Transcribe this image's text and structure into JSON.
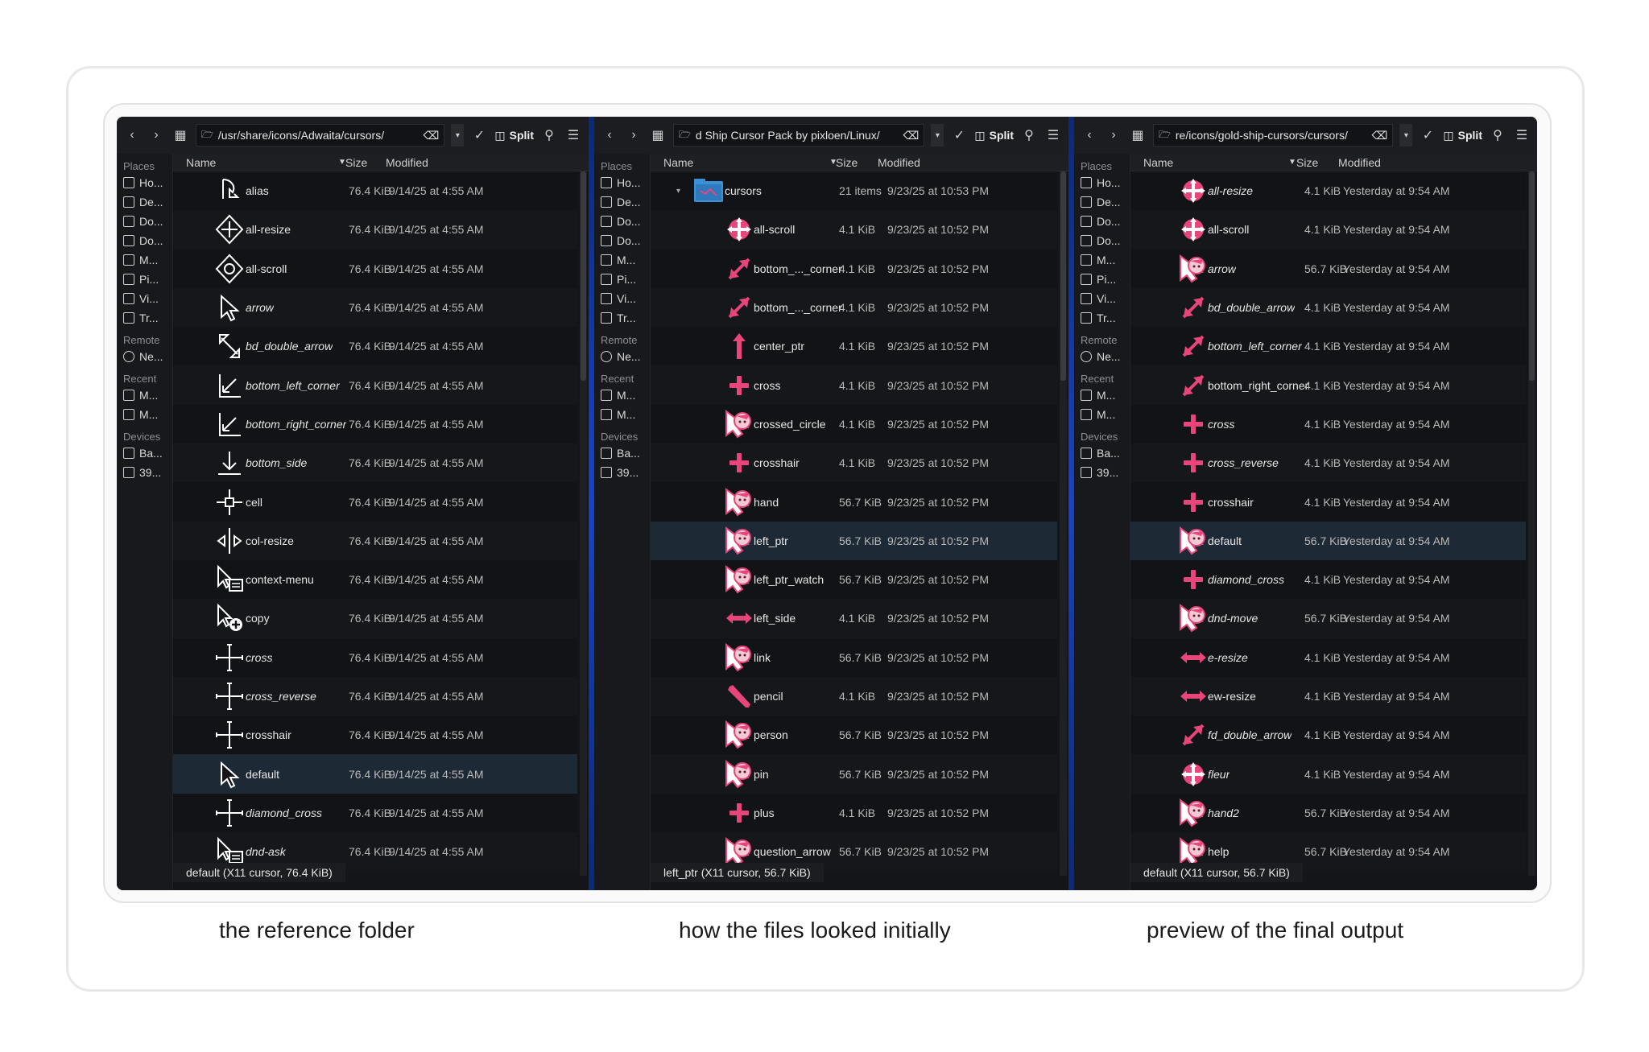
{
  "captions": [
    "the reference folder",
    "how the files looked initially",
    "preview of the final output"
  ],
  "toolbar": {
    "split_label": "Split"
  },
  "sidebar": {
    "places_header": "Places",
    "places": [
      "Ho...",
      "De...",
      "Do...",
      "Do...",
      "M...",
      "Pi...",
      "Vi...",
      "Tr..."
    ],
    "remote_header": "Remote",
    "remote": [
      "Ne..."
    ],
    "recent_header": "Recent",
    "recent": [
      "M...",
      "M..."
    ],
    "devices_header": "Devices",
    "devices": [
      "Ba...",
      "39..."
    ]
  },
  "columns": {
    "name": "Name",
    "size": "Size",
    "modified": "Modified"
  },
  "panels": [
    {
      "path": "/usr/share/icons/Adwaita/cursors/",
      "status": "default (X11 cursor, 76.4 KiB)",
      "icon_style": "adwaita",
      "selected_index": 15,
      "rows": [
        {
          "name": "alias",
          "italic": false,
          "size": "76.4 KiB",
          "modified": "9/14/25 at 4:55 AM",
          "icon": "alias-cursor-icon"
        },
        {
          "name": "all-resize",
          "italic": false,
          "size": "76.4 KiB",
          "modified": "9/14/25 at 4:55 AM",
          "icon": "all-resize-cursor-icon"
        },
        {
          "name": "all-scroll",
          "italic": false,
          "size": "76.4 KiB",
          "modified": "9/14/25 at 4:55 AM",
          "icon": "all-scroll-cursor-icon"
        },
        {
          "name": "arrow",
          "italic": true,
          "size": "76.4 KiB",
          "modified": "9/14/25 at 4:55 AM",
          "icon": "arrow-cursor-icon"
        },
        {
          "name": "bd_double_arrow",
          "italic": true,
          "size": "76.4 KiB",
          "modified": "9/14/25 at 4:55 AM",
          "icon": "diagonal-resize-cursor-icon"
        },
        {
          "name": "bottom_left_corner",
          "italic": true,
          "size": "76.4 KiB",
          "modified": "9/14/25 at 4:55 AM",
          "icon": "corner-cursor-icon"
        },
        {
          "name": "bottom_right_corner",
          "italic": true,
          "size": "76.4 KiB",
          "modified": "9/14/25 at 4:55 AM",
          "icon": "corner-cursor-icon"
        },
        {
          "name": "bottom_side",
          "italic": true,
          "size": "76.4 KiB",
          "modified": "9/14/25 at 4:55 AM",
          "icon": "side-cursor-icon"
        },
        {
          "name": "cell",
          "italic": false,
          "size": "76.4 KiB",
          "modified": "9/14/25 at 4:55 AM",
          "icon": "cell-cursor-icon"
        },
        {
          "name": "col-resize",
          "italic": false,
          "size": "76.4 KiB",
          "modified": "9/14/25 at 4:55 AM",
          "icon": "col-resize-cursor-icon"
        },
        {
          "name": "context-menu",
          "italic": false,
          "size": "76.4 KiB",
          "modified": "9/14/25 at 4:55 AM",
          "icon": "context-menu-cursor-icon"
        },
        {
          "name": "copy",
          "italic": false,
          "size": "76.4 KiB",
          "modified": "9/14/25 at 4:55 AM",
          "icon": "copy-cursor-icon"
        },
        {
          "name": "cross",
          "italic": true,
          "size": "76.4 KiB",
          "modified": "9/14/25 at 4:55 AM",
          "icon": "cross-cursor-icon"
        },
        {
          "name": "cross_reverse",
          "italic": true,
          "size": "76.4 KiB",
          "modified": "9/14/25 at 4:55 AM",
          "icon": "cross-cursor-icon"
        },
        {
          "name": "crosshair",
          "italic": false,
          "size": "76.4 KiB",
          "modified": "9/14/25 at 4:55 AM",
          "icon": "cross-cursor-icon"
        },
        {
          "name": "default",
          "italic": false,
          "size": "76.4 KiB",
          "modified": "9/14/25 at 4:55 AM",
          "icon": "arrow-cursor-icon"
        },
        {
          "name": "diamond_cross",
          "italic": true,
          "size": "76.4 KiB",
          "modified": "9/14/25 at 4:55 AM",
          "icon": "cross-cursor-icon"
        },
        {
          "name": "dnd-ask",
          "italic": true,
          "size": "76.4 KiB",
          "modified": "9/14/25 at 4:55 AM",
          "icon": "context-menu-cursor-icon"
        }
      ]
    },
    {
      "path": "d Ship Cursor Pack by pixloen/Linux/",
      "status": "left_ptr (X11 cursor, 56.7 KiB)",
      "icon_style": "pink",
      "selected_index": 9,
      "rows": [
        {
          "name": "cursors",
          "italic": false,
          "size": "21 items",
          "modified": "9/23/25 at 10:53 PM",
          "icon": "folder-icon",
          "folder": true
        },
        {
          "name": "all-scroll",
          "italic": false,
          "size": "4.1 KiB",
          "modified": "9/23/25 at 10:52 PM",
          "icon": "all-resize-cursor-icon"
        },
        {
          "name": "bottom_..._corner",
          "italic": false,
          "size": "4.1 KiB",
          "modified": "9/23/25 at 10:52 PM",
          "icon": "diagonal-arrow-cursor-icon"
        },
        {
          "name": "bottom_..._corner",
          "italic": false,
          "size": "4.1 KiB",
          "modified": "9/23/25 at 10:52 PM",
          "icon": "diagonal-arrow-cursor-icon"
        },
        {
          "name": "center_ptr",
          "italic": false,
          "size": "4.1 KiB",
          "modified": "9/23/25 at 10:52 PM",
          "icon": "up-arrow-cursor-icon"
        },
        {
          "name": "cross",
          "italic": false,
          "size": "4.1 KiB",
          "modified": "9/23/25 at 10:52 PM",
          "icon": "plus-cursor-icon"
        },
        {
          "name": "crossed_circle",
          "italic": false,
          "size": "4.1 KiB",
          "modified": "9/23/25 at 10:52 PM",
          "icon": "character-cursor-icon"
        },
        {
          "name": "crosshair",
          "italic": false,
          "size": "4.1 KiB",
          "modified": "9/23/25 at 10:52 PM",
          "icon": "plus-cursor-icon"
        },
        {
          "name": "hand",
          "italic": false,
          "size": "56.7 KiB",
          "modified": "9/23/25 at 10:52 PM",
          "icon": "character-cursor-icon"
        },
        {
          "name": "left_ptr",
          "italic": false,
          "size": "56.7 KiB",
          "modified": "9/23/25 at 10:52 PM",
          "icon": "character-cursor-icon"
        },
        {
          "name": "left_ptr_watch",
          "italic": false,
          "size": "56.7 KiB",
          "modified": "9/23/25 at 10:52 PM",
          "icon": "character-cursor-icon"
        },
        {
          "name": "left_side",
          "italic": false,
          "size": "4.1 KiB",
          "modified": "9/23/25 at 10:52 PM",
          "icon": "horizontal-arrow-cursor-icon"
        },
        {
          "name": "link",
          "italic": false,
          "size": "56.7 KiB",
          "modified": "9/23/25 at 10:52 PM",
          "icon": "character-cursor-icon"
        },
        {
          "name": "pencil",
          "italic": false,
          "size": "4.1 KiB",
          "modified": "9/23/25 at 10:52 PM",
          "icon": "pencil-cursor-icon"
        },
        {
          "name": "person",
          "italic": false,
          "size": "56.7 KiB",
          "modified": "9/23/25 at 10:52 PM",
          "icon": "character-cursor-icon"
        },
        {
          "name": "pin",
          "italic": false,
          "size": "56.7 KiB",
          "modified": "9/23/25 at 10:52 PM",
          "icon": "character-cursor-icon"
        },
        {
          "name": "plus",
          "italic": false,
          "size": "4.1 KiB",
          "modified": "9/23/25 at 10:52 PM",
          "icon": "plus-cursor-icon"
        },
        {
          "name": "question_arrow",
          "italic": false,
          "size": "56.7 KiB",
          "modified": "9/23/25 at 10:52 PM",
          "icon": "character-cursor-icon"
        }
      ]
    },
    {
      "path": "re/icons/gold-ship-cursors/cursors/",
      "status": "default (X11 cursor, 56.7 KiB)",
      "icon_style": "pink",
      "selected_index": 9,
      "rows": [
        {
          "name": "all-resize",
          "italic": true,
          "size": "4.1 KiB",
          "modified": "Yesterday at 9:54 AM",
          "icon": "all-resize-cursor-icon"
        },
        {
          "name": "all-scroll",
          "italic": false,
          "size": "4.1 KiB",
          "modified": "Yesterday at 9:54 AM",
          "icon": "all-resize-cursor-icon"
        },
        {
          "name": "arrow",
          "italic": true,
          "size": "56.7 KiB",
          "modified": "Yesterday at 9:54 AM",
          "icon": "character-cursor-icon"
        },
        {
          "name": "bd_double_arrow",
          "italic": true,
          "size": "4.1 KiB",
          "modified": "Yesterday at 9:54 AM",
          "icon": "diagonal-arrow-cursor-icon"
        },
        {
          "name": "bottom_left_corner",
          "italic": true,
          "size": "4.1 KiB",
          "modified": "Yesterday at 9:54 AM",
          "icon": "diagonal-arrow-cursor-icon"
        },
        {
          "name": "bottom_right_corner",
          "italic": false,
          "size": "4.1 KiB",
          "modified": "Yesterday at 9:54 AM",
          "icon": "diagonal-arrow-cursor-icon"
        },
        {
          "name": "cross",
          "italic": true,
          "size": "4.1 KiB",
          "modified": "Yesterday at 9:54 AM",
          "icon": "plus-cursor-icon"
        },
        {
          "name": "cross_reverse",
          "italic": true,
          "size": "4.1 KiB",
          "modified": "Yesterday at 9:54 AM",
          "icon": "plus-cursor-icon"
        },
        {
          "name": "crosshair",
          "italic": false,
          "size": "4.1 KiB",
          "modified": "Yesterday at 9:54 AM",
          "icon": "plus-cursor-icon"
        },
        {
          "name": "default",
          "italic": false,
          "size": "56.7 KiB",
          "modified": "Yesterday at 9:54 AM",
          "icon": "character-cursor-icon"
        },
        {
          "name": "diamond_cross",
          "italic": true,
          "size": "4.1 KiB",
          "modified": "Yesterday at 9:54 AM",
          "icon": "plus-cursor-icon"
        },
        {
          "name": "dnd-move",
          "italic": true,
          "size": "56.7 KiB",
          "modified": "Yesterday at 9:54 AM",
          "icon": "character-cursor-icon"
        },
        {
          "name": "e-resize",
          "italic": true,
          "size": "4.1 KiB",
          "modified": "Yesterday at 9:54 AM",
          "icon": "horizontal-arrow-cursor-icon"
        },
        {
          "name": "ew-resize",
          "italic": false,
          "size": "4.1 KiB",
          "modified": "Yesterday at 9:54 AM",
          "icon": "horizontal-arrow-cursor-icon"
        },
        {
          "name": "fd_double_arrow",
          "italic": true,
          "size": "4.1 KiB",
          "modified": "Yesterday at 9:54 AM",
          "icon": "diagonal-arrow-cursor-icon"
        },
        {
          "name": "fleur",
          "italic": true,
          "size": "4.1 KiB",
          "modified": "Yesterday at 9:54 AM",
          "icon": "all-resize-cursor-icon"
        },
        {
          "name": "hand2",
          "italic": true,
          "size": "56.7 KiB",
          "modified": "Yesterday at 9:54 AM",
          "icon": "character-cursor-icon"
        },
        {
          "name": "help",
          "italic": false,
          "size": "56.7 KiB",
          "modified": "Yesterday at 9:54 AM",
          "icon": "character-cursor-icon"
        }
      ]
    }
  ],
  "colors": {
    "accent_pink": "#e8457a",
    "selection": "#1d2a36",
    "folder_blue": "#3a8fd6"
  }
}
